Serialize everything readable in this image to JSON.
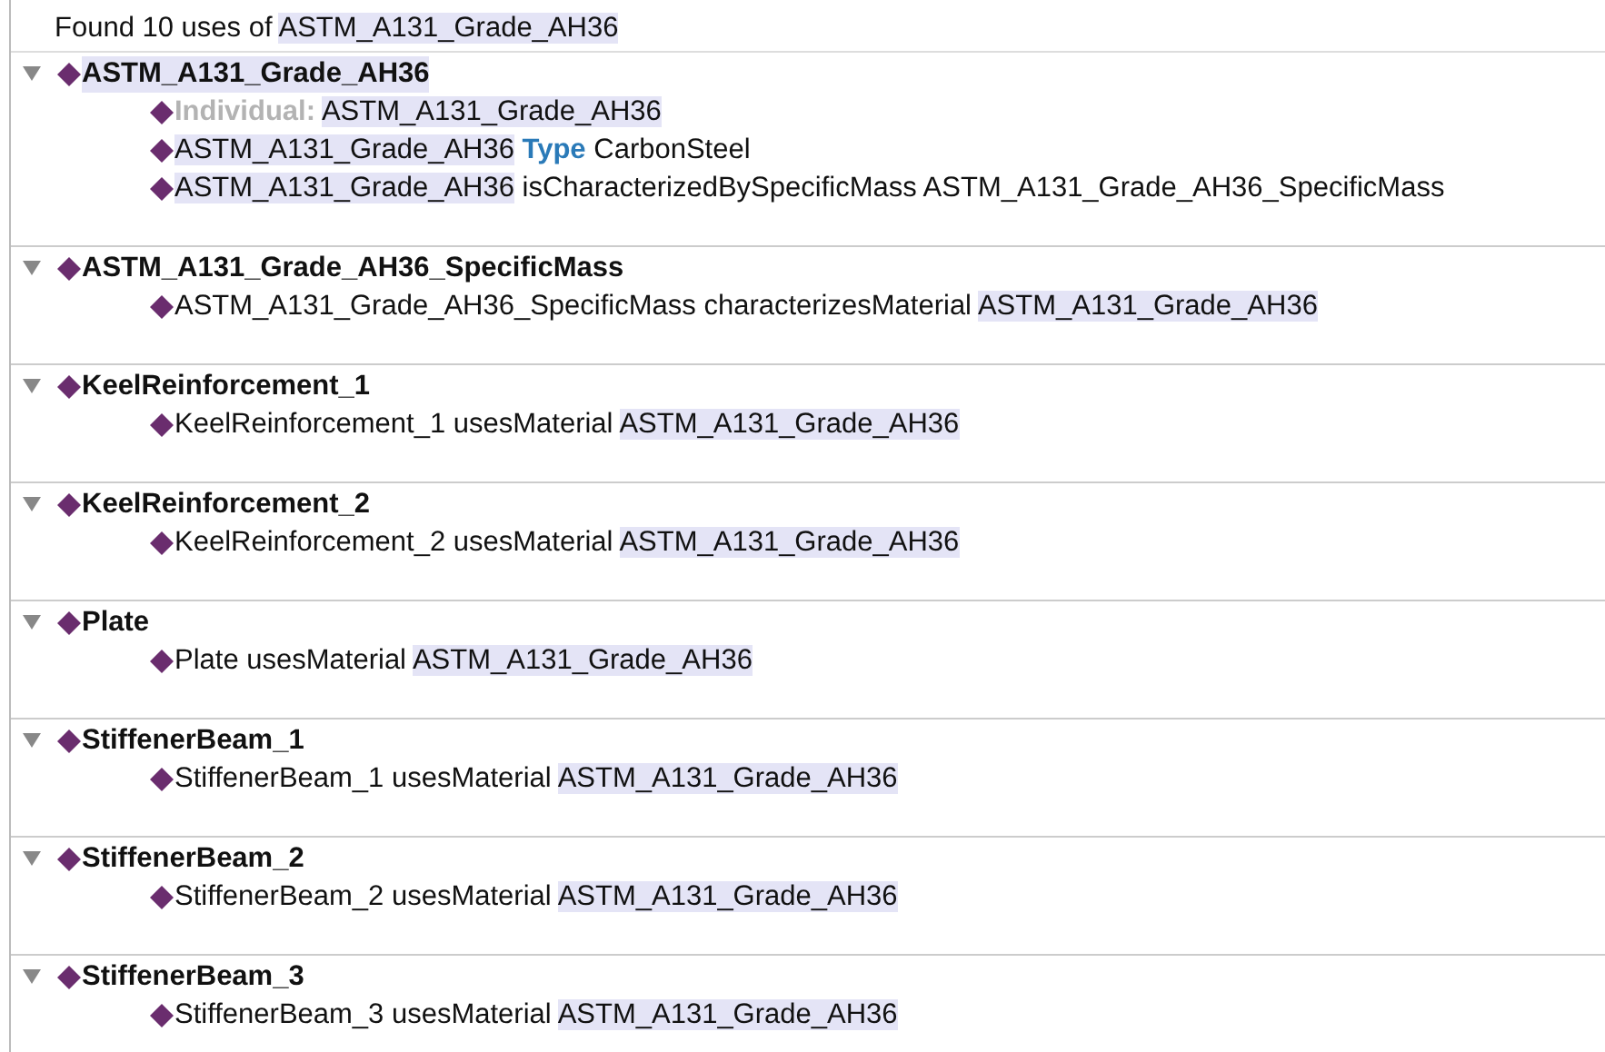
{
  "summary": [
    {
      "kind": "plain",
      "text": "Found 10 uses of"
    },
    {
      "kind": "highlight",
      "text": "ASTM_A131_Grade_AH36"
    }
  ],
  "sections": [
    {
      "name": "ASTM_A131_Grade_AH36",
      "expanded": true,
      "highlighted": true,
      "children": [
        [
          {
            "kind": "label",
            "text": "Individual:"
          },
          {
            "kind": "highlight",
            "text": "ASTM_A131_Grade_AH36"
          }
        ],
        [
          {
            "kind": "highlight",
            "text": "ASTM_A131_Grade_AH36"
          },
          {
            "kind": "keyword",
            "text": "Type"
          },
          {
            "kind": "plain",
            "text": "CarbonSteel"
          }
        ],
        [
          {
            "kind": "highlight",
            "text": "ASTM_A131_Grade_AH36"
          },
          {
            "kind": "plain",
            "text": "isCharacterizedBySpecificMass ASTM_A131_Grade_AH36_SpecificMass"
          }
        ]
      ]
    },
    {
      "name": "ASTM_A131_Grade_AH36_SpecificMass",
      "expanded": true,
      "highlighted": false,
      "children": [
        [
          {
            "kind": "plain",
            "text": "ASTM_A131_Grade_AH36_SpecificMass characterizesMaterial"
          },
          {
            "kind": "highlight",
            "text": "ASTM_A131_Grade_AH36"
          }
        ]
      ]
    },
    {
      "name": "KeelReinforcement_1",
      "expanded": true,
      "highlighted": false,
      "children": [
        [
          {
            "kind": "plain",
            "text": "KeelReinforcement_1 usesMaterial"
          },
          {
            "kind": "highlight",
            "text": "ASTM_A131_Grade_AH36"
          }
        ]
      ]
    },
    {
      "name": "KeelReinforcement_2",
      "expanded": true,
      "highlighted": false,
      "children": [
        [
          {
            "kind": "plain",
            "text": "KeelReinforcement_2 usesMaterial"
          },
          {
            "kind": "highlight",
            "text": "ASTM_A131_Grade_AH36"
          }
        ]
      ]
    },
    {
      "name": "Plate",
      "expanded": true,
      "highlighted": false,
      "children": [
        [
          {
            "kind": "plain",
            "text": "Plate usesMaterial"
          },
          {
            "kind": "highlight",
            "text": "ASTM_A131_Grade_AH36"
          }
        ]
      ]
    },
    {
      "name": "StiffenerBeam_1",
      "expanded": true,
      "highlighted": false,
      "children": [
        [
          {
            "kind": "plain",
            "text": "StiffenerBeam_1 usesMaterial"
          },
          {
            "kind": "highlight",
            "text": "ASTM_A131_Grade_AH36"
          }
        ]
      ]
    },
    {
      "name": "StiffenerBeam_2",
      "expanded": true,
      "highlighted": false,
      "children": [
        [
          {
            "kind": "plain",
            "text": "StiffenerBeam_2 usesMaterial"
          },
          {
            "kind": "highlight",
            "text": "ASTM_A131_Grade_AH36"
          }
        ]
      ]
    },
    {
      "name": "StiffenerBeam_3",
      "expanded": true,
      "highlighted": false,
      "children": [
        [
          {
            "kind": "plain",
            "text": "StiffenerBeam_3 usesMaterial"
          },
          {
            "kind": "highlight",
            "text": "ASTM_A131_Grade_AH36"
          }
        ]
      ]
    }
  ]
}
